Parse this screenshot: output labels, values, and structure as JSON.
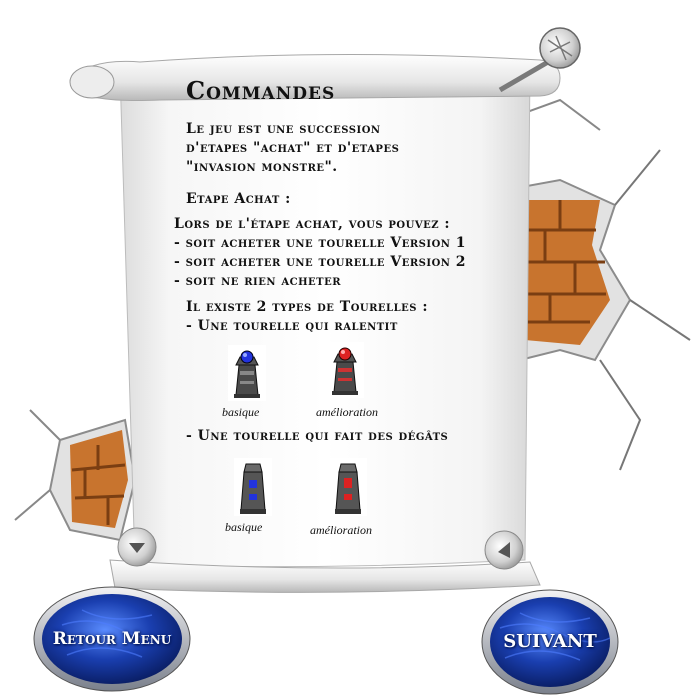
{
  "title": "Commandes",
  "intro": [
    "Le jeu est une succession",
    "d'etapes \"achat\" et d'etapes",
    "\"invasion monstre\"."
  ],
  "etape_heading": "Etape Achat :",
  "achat_lines": [
    "Lors de l'étape achat, vous pouvez :",
    "- soit acheter une tourelle Version 1",
    "- soit acheter une tourelle Version 2",
    "- soit ne rien acheter"
  ],
  "types_heading": "Il existe 2 types de Tourelles :",
  "slow": {
    "heading": "- Une tourelle qui ralentit",
    "basic_label": "basique",
    "upgrade_label": "amélioration",
    "basic_icon": "blue-orb-tower-icon",
    "upgrade_icon": "red-orb-tower-icon"
  },
  "damage": {
    "heading": "- Une tourelle qui fait des dégâts",
    "basic_label": "basique",
    "upgrade_label": "amélioration",
    "basic_icon": "blue-cannon-tower-icon",
    "upgrade_icon": "red-cannon-tower-icon"
  },
  "buttons": {
    "back": "Retour Menu",
    "next": "SUIVANT"
  },
  "colors": {
    "brick": "#c8742e",
    "button_blue": "#1a3fb0",
    "button_rim": "#9aa0ac",
    "blue_orb": "#2233dd",
    "red_orb": "#dd2222"
  }
}
